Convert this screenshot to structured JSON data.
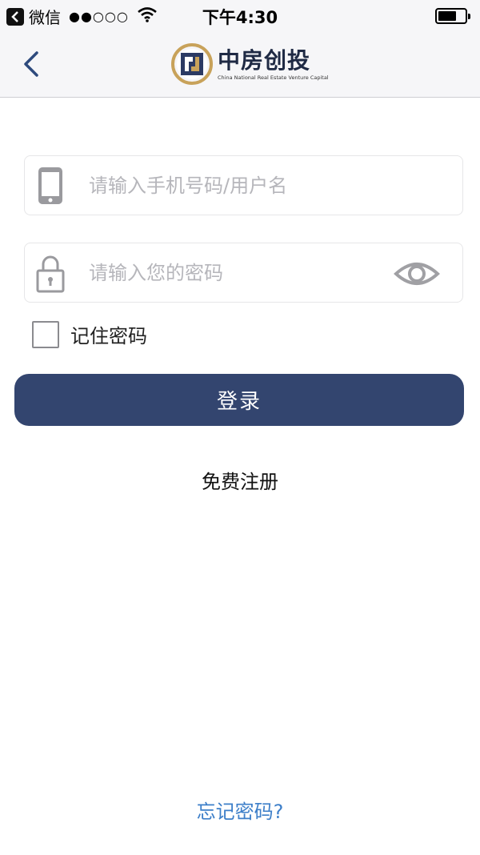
{
  "status_bar": {
    "app_name": "微信",
    "signal": "●●○○○",
    "time": "下午4:30",
    "battery_level": 0.7
  },
  "nav": {
    "logo_cn": "中房创投",
    "logo_en": "China National Real Estate Venture Capital"
  },
  "form": {
    "username_placeholder": "请输入手机号码/用户名",
    "username_value": "",
    "password_placeholder": "请输入您的密码",
    "password_value": "",
    "remember_label": "记住密码",
    "remember_checked": false,
    "login_label": "登录",
    "register_label": "免费注册",
    "forgot_label": "忘记密码?"
  },
  "colors": {
    "primary": "#33456f",
    "link": "#3d7fc9",
    "placeholder": "#b6b6bb",
    "icon_gray": "#9a9a9e",
    "logo_gold": "#c8a25a"
  }
}
